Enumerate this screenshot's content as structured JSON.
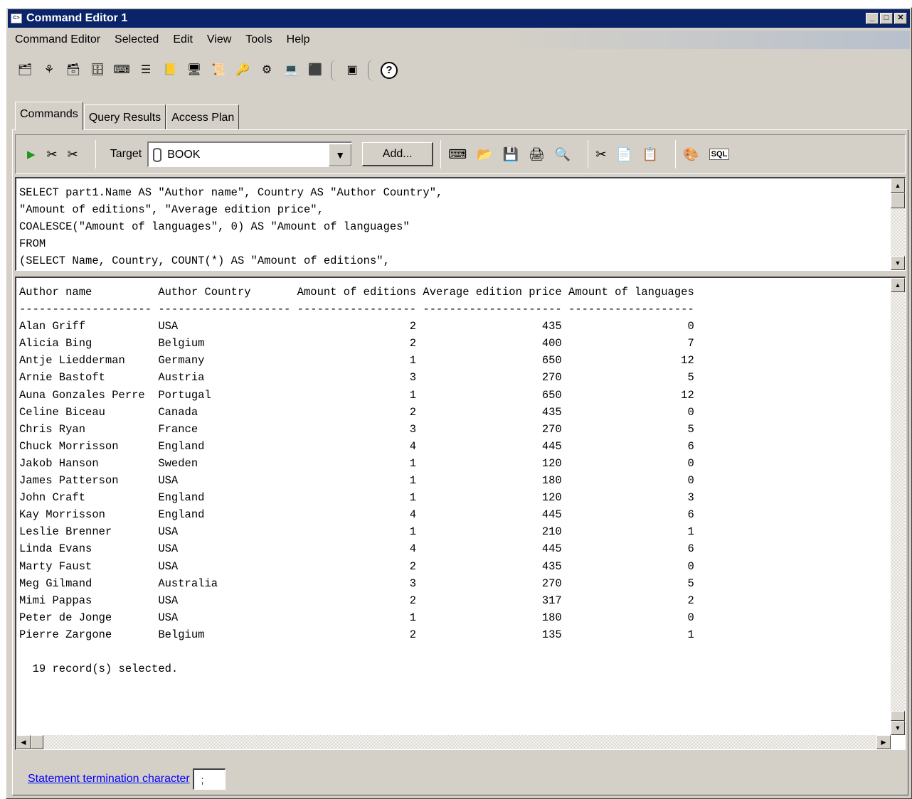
{
  "window": {
    "title": "Command Editor 1",
    "minimize": "_",
    "maximize": "□",
    "close": "✕"
  },
  "menu": [
    "Command Editor",
    "Selected",
    "Edit",
    "View",
    "Tools",
    "Help"
  ],
  "toolbar_icons": [
    "control-center-icon",
    "replication-center-icon",
    "satellite-admin-icon",
    "data-warehouse-icon",
    "command-editor-icon",
    "task-center-icon",
    "journal-icon",
    "health-center-icon",
    "license-center-icon",
    "configuration-assistant-icon",
    "development-center-icon",
    "web-tools-icon",
    "info-center-icon",
    "memory-visualizer-icon",
    "help-icon"
  ],
  "tabs": [
    "Commands",
    "Query Results",
    "Access Plan"
  ],
  "editor_toolbar": {
    "target_label": "Target",
    "target_value": "BOOK",
    "add_label": "Add..."
  },
  "sql_lines": [
    "SELECT part1.Name AS \"Author name\", Country AS \"Author Country\",",
    "\"Amount of editions\", \"Average edition price\",",
    "COALESCE(\"Amount of languages\", 0) AS \"Amount of languages\"",
    "FROM",
    "(SELECT Name, Country, COUNT(*) AS \"Amount of editions\","
  ],
  "results": {
    "header": "Author name          Author Country       Amount of editions Average edition price Amount of languages",
    "divider": "-------------------- -------------------- ------------------ --------------------- -------------------",
    "rows": [
      "Alan Griff           USA                                   2                   435                   0",
      "Alicia Bing          Belgium                               2                   400                   7",
      "Antje Liedderman     Germany                               1                   650                  12",
      "Arnie Bastoft        Austria                               3                   270                   5",
      "Auna Gonzales Perre  Portugal                              1                   650                  12",
      "Celine Biceau        Canada                                2                   435                   0",
      "Chris Ryan           France                                3                   270                   5",
      "Chuck Morrisson      England                               4                   445                   6",
      "Jakob Hanson         Sweden                                1                   120                   0",
      "James Patterson      USA                                   1                   180                   0",
      "John Craft           England                               1                   120                   3",
      "Kay Morrisson        England                               4                   445                   6",
      "Leslie Brenner       USA                                   1                   210                   1",
      "Linda Evans          USA                                   4                   445                   6",
      "Marty Faust          USA                                   2                   435                   0",
      "Meg Gilmand          Australia                             3                   270                   5",
      "Mimi Pappas          USA                                   2                   317                   2",
      "Peter de Jonge       USA                                   1                   180                   0",
      "Pierre Zargone       Belgium                               2                   135                   1"
    ],
    "summary": "  19 record(s) selected."
  },
  "footer": {
    "link_label": "Statement termination character",
    "termination_char": ";"
  },
  "colors": {
    "titlebar": "#0a246a",
    "face": "#d4d0c8",
    "link": "#0000ff",
    "run": "#1a9a1a"
  }
}
